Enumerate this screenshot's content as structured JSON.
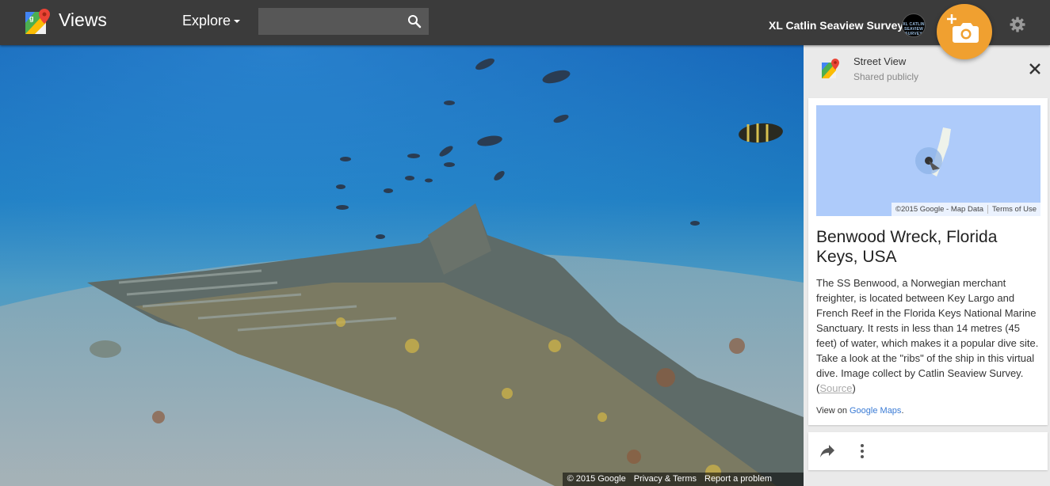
{
  "header": {
    "app_title": "Views",
    "explore_label": "Explore",
    "search_placeholder": "",
    "account_name": "XL Catlin Seaview Survey",
    "avatar_text": "XL CATLIN SEAVIEW SURVEY"
  },
  "icons": {
    "logo": "google-maps-pin-icon",
    "search": "search-icon",
    "settings": "gear-icon",
    "fab": "add-photo-camera-icon",
    "close": "close-icon",
    "share": "share-arrow-icon",
    "more": "more-vert-icon"
  },
  "colors": {
    "topbar": "#3b3b3b",
    "fab": "#f0a030",
    "link": "#3a7bd5",
    "map_water": "#aecbfa"
  },
  "panorama": {
    "footer_copyright": "© 2015 Google",
    "footer_privacy": "Privacy & Terms",
    "footer_report": "Report a problem"
  },
  "panel": {
    "source_title": "Street View",
    "source_subtitle": "Shared publicly",
    "map_attribution": "©2015 Google - Map Data",
    "map_terms": "Terms of Use",
    "place_title": "Benwood Wreck, Florida Keys, USA",
    "description": "The SS Benwood, a Norwegian merchant freighter, is located between Key Largo and French Reef in the Florida Keys National Marine Sanctuary. It rests in less than 14 metres (45 feet) of water, which makes it a popular dive site. Take a look at the \"ribs\" of the ship in this virtual dive. Image collect by Catlin Seaview Survey. (",
    "source_link": "Source",
    "description_end": ")",
    "view_on_prefix": "View on ",
    "view_on_link": "Google Maps",
    "view_on_suffix": "."
  }
}
